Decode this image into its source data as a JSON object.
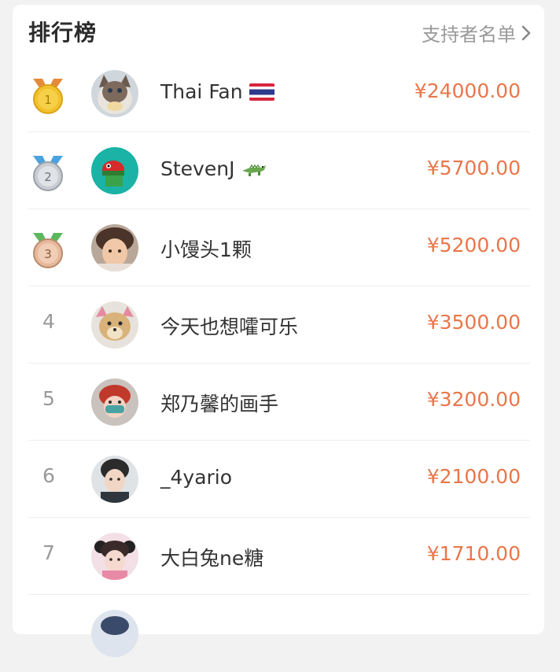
{
  "header": {
    "title": "排行榜",
    "supporters_link_label": "支持者名单"
  },
  "rankings": [
    {
      "rank": "1",
      "name": "Thai Fan",
      "emoji": "thailand-flag",
      "amount": "¥24000.00",
      "medal": "gold"
    },
    {
      "rank": "2",
      "name": "StevenJ",
      "emoji": "crocodile",
      "amount": "¥5700.00",
      "medal": "silver"
    },
    {
      "rank": "3",
      "name": "小馒头1颗",
      "emoji": "",
      "amount": "¥5200.00",
      "medal": "bronze"
    },
    {
      "rank": "4",
      "name": "今天也想嚯可乐",
      "emoji": "",
      "amount": "¥3500.00",
      "medal": ""
    },
    {
      "rank": "5",
      "name": "郑乃馨的画手",
      "emoji": "",
      "amount": "¥3200.00",
      "medal": ""
    },
    {
      "rank": "6",
      "name": "_4yario",
      "emoji": "",
      "amount": "¥2100.00",
      "medal": ""
    },
    {
      "rank": "7",
      "name": "大白兔ne糖",
      "emoji": "",
      "amount": "¥1710.00",
      "medal": ""
    }
  ],
  "colors": {
    "amount": "#e8774a",
    "gold": "#f2c12e",
    "silver": "#c9cdd2",
    "bronze": "#e7b89a",
    "ribbon_orange": "#e58a3a",
    "ribbon_blue": "#4aa3df",
    "ribbon_green": "#5cb85c"
  }
}
